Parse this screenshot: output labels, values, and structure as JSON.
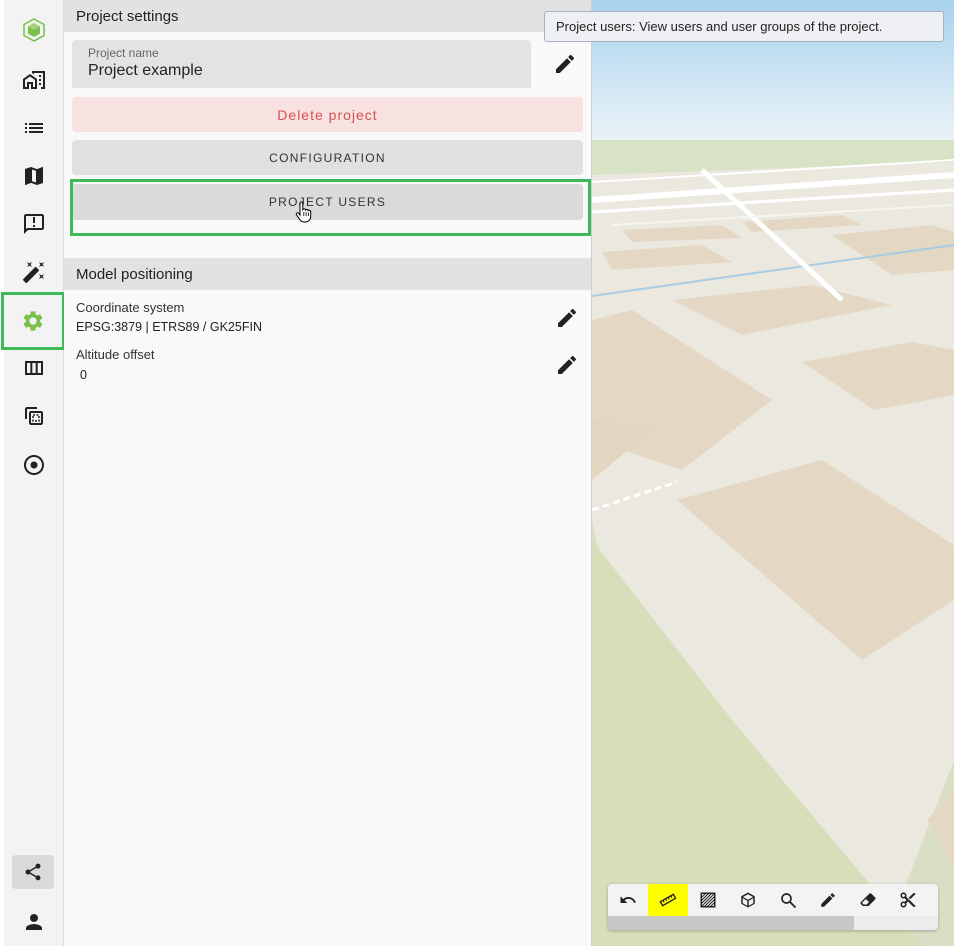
{
  "rail": {
    "items": [
      {
        "icon": "logo-icon"
      },
      {
        "icon": "buildings-icon"
      },
      {
        "icon": "list-icon"
      },
      {
        "icon": "map-icon"
      },
      {
        "icon": "feedback-icon"
      },
      {
        "icon": "magic-wand-icon"
      },
      {
        "icon": "gear-icon",
        "active": true
      },
      {
        "icon": "columns-icon"
      },
      {
        "icon": "compare-icon"
      },
      {
        "icon": "target-icon"
      },
      {
        "icon": "share-icon"
      },
      {
        "icon": "person-icon"
      }
    ],
    "accent": "#3dbb5a",
    "active_icon_color": "#7bc04b"
  },
  "project_settings": {
    "header": "Project settings",
    "name_label": "Project name",
    "name_value": "Project example",
    "delete_label": "Delete project",
    "configuration_label": "CONFIGURATION",
    "users_label": "PROJECT USERS"
  },
  "model_positioning": {
    "header": "Model positioning",
    "coord_label": "Coordinate system",
    "coord_value": "EPSG:3879 | ETRS89 / GK25FIN",
    "altitude_label": "Altitude offset",
    "altitude_value": "0"
  },
  "tooltip": {
    "text": "Project users: View users and user groups of the project."
  },
  "toolbar": {
    "tools": [
      {
        "icon": "undo-icon"
      },
      {
        "icon": "ruler-icon",
        "active": true
      },
      {
        "icon": "hatch-icon"
      },
      {
        "icon": "cube-icon"
      },
      {
        "icon": "zoom-search-icon"
      },
      {
        "icon": "pen-icon"
      },
      {
        "icon": "eraser-icon"
      },
      {
        "icon": "scissors-icon"
      }
    ],
    "active_color": "#ffff00"
  },
  "colors": {
    "delete_bg": "#f8e1e1",
    "delete_text": "#d65151",
    "highlight": "#3dbb5a"
  }
}
